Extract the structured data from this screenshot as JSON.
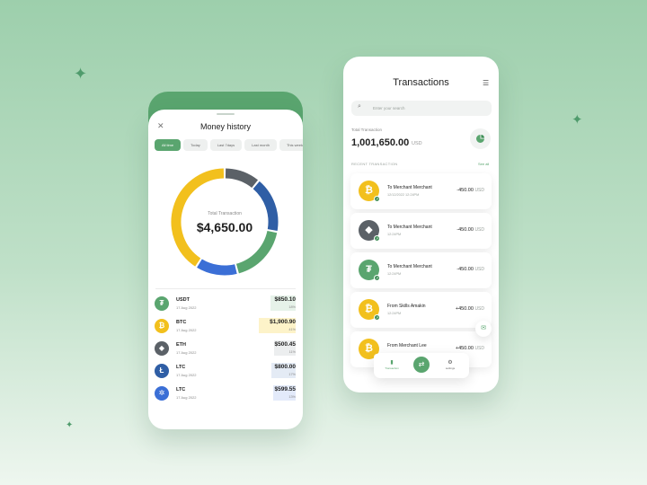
{
  "money_history": {
    "close_icon": "close-icon",
    "title": "Money history",
    "filters": [
      {
        "label": "All time",
        "active": true
      },
      {
        "label": "Today",
        "active": false
      },
      {
        "label": "Last 7days",
        "active": false
      },
      {
        "label": "Last month",
        "active": false
      },
      {
        "label": "This week",
        "active": false
      }
    ],
    "total_label": "Total Transaction",
    "total_value": "$4,650.00",
    "assets": [
      {
        "symbol": "USDT",
        "date": "17 Aug 2022",
        "amount": "$850.10",
        "pct": "18%",
        "share": 18,
        "icon": "tether-icon",
        "glyph": "₮",
        "color": "#5aa56f",
        "bar_color": "#e6f2e9"
      },
      {
        "symbol": "BTC",
        "date": "17 Aug 2022",
        "amount": "$1,900.90",
        "pct": "41%",
        "share": 41,
        "icon": "bitcoin-icon",
        "glyph": "₿",
        "color": "#f2c01d",
        "bar_color": "#fdf3c9"
      },
      {
        "symbol": "ETH",
        "date": "17 Aug 2022",
        "amount": "$500.45",
        "pct": "11%",
        "share": 11,
        "icon": "ethereum-icon",
        "glyph": "◆",
        "color": "#5b6167",
        "bar_color": "#eceeef"
      },
      {
        "symbol": "LTC",
        "date": "17 Aug 2022",
        "amount": "$800.00",
        "pct": "17%",
        "share": 17,
        "icon": "litecoin-icon",
        "glyph": "Ł",
        "color": "#2f5ea5",
        "bar_color": "#e4ebf5"
      },
      {
        "symbol": "LTC",
        "date": "17 Aug 2022",
        "amount": "$599.55",
        "pct": "13%",
        "share": 13,
        "icon": "cardano-icon",
        "glyph": "✲",
        "color": "#3b6fd6",
        "bar_color": "#e3eafa"
      }
    ]
  },
  "transactions": {
    "title": "Transactions",
    "filter_icon": "sliders-icon",
    "search_placeholder": "Enter your search",
    "total_label": "Total Transaction",
    "total_value": "1,001,650.00",
    "total_currency": "USD",
    "pie_icon": "pie-chart-icon",
    "recent_label": "RECENT TRANSACTION",
    "see_all": "See all",
    "items": [
      {
        "title": "To Merchant Merchant",
        "time": "12/12/2022 12:24PM",
        "amount": "-450.00",
        "currency": "USD",
        "glyph": "₿",
        "color": "#f2c01d",
        "icon": "bitcoin-icon"
      },
      {
        "title": "To Merchant Merchant",
        "time": "12:24PM",
        "amount": "-450.00",
        "currency": "USD",
        "glyph": "◆",
        "color": "#5b6167",
        "icon": "ethereum-icon"
      },
      {
        "title": "To Merchant Merchant",
        "time": "12:24PM",
        "amount": "-450.00",
        "currency": "USD",
        "glyph": "₮",
        "color": "#5aa56f",
        "icon": "tether-icon"
      },
      {
        "title": "From Skills Amakin",
        "time": "12:24PM",
        "amount": "+450.00",
        "currency": "USD",
        "glyph": "₿",
        "color": "#f2c01d",
        "icon": "bitcoin-icon"
      },
      {
        "title": "From Merchant Lee",
        "time": "",
        "amount": "+450.00",
        "currency": "USD",
        "glyph": "₿",
        "color": "#f2c01d",
        "icon": "bitcoin-icon"
      }
    ],
    "nav": {
      "left_label": "Transaction",
      "right_label": "settings"
    }
  },
  "chart_data": {
    "type": "pie",
    "categories": [
      "USDT",
      "BTC",
      "ETH",
      "LTC",
      "LTC"
    ],
    "values": [
      18,
      41,
      11,
      17,
      13
    ],
    "colors": [
      "#5aa56f",
      "#f2c01d",
      "#5b6167",
      "#2f5ea5",
      "#3b6fd6"
    ],
    "title": "",
    "xlabel": "",
    "ylabel": ""
  },
  "colors": {
    "accent": "#5aa56f",
    "background": "#9dcfac"
  }
}
